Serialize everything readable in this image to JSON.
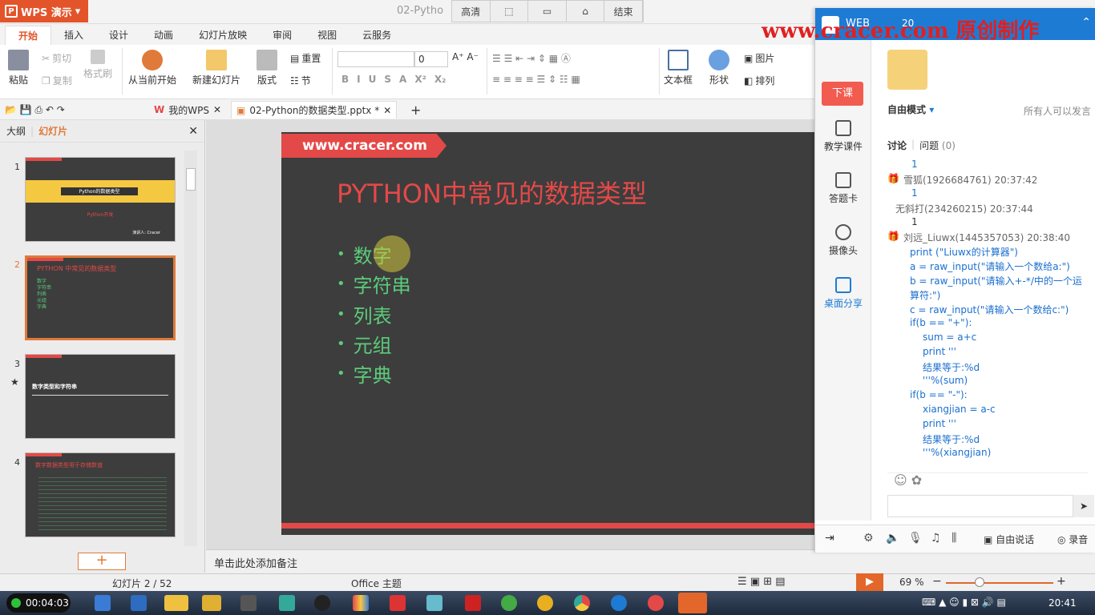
{
  "app": {
    "name": "WPS 演示",
    "doc_title_short": "02-Pytho"
  },
  "float_bar": [
    "高清",
    "",
    "",
    "",
    "结束"
  ],
  "menu_tabs": [
    "开始",
    "插入",
    "设计",
    "动画",
    "幻灯片放映",
    "审阅",
    "视图",
    "云服务"
  ],
  "ribbon": {
    "paste": "粘贴",
    "cut": "剪切",
    "copy": "复制",
    "format_painter": "格式刷",
    "from_current": "从当前开始",
    "new_slide": "新建幻灯片",
    "layout": "版式",
    "reset": "重置",
    "section": "节",
    "font_size": "0",
    "textbox": "文本框",
    "shape": "形状",
    "picture": "图片",
    "arrange": "排列"
  },
  "doc_tabs": {
    "my_wps": "我的WPS",
    "current": "02-Python的数据类型.pptx *"
  },
  "left_panel": {
    "outline": "大纲",
    "slides": "幻灯片"
  },
  "thumbs": {
    "t1_title": "Python的数据类型",
    "t1_sub": "Python开发",
    "t1_author": "演讲人: Cracer",
    "t2_title": "PYTHON 中常见的数据类型",
    "t2_items": [
      "数字",
      "字符串",
      "列表",
      "元组",
      "字典"
    ],
    "t3_title": "数字类型和字符串",
    "t4_title": "数字数据类型用于存储数值"
  },
  "slide": {
    "banner": "www.cracer.com",
    "title": "PYTHON中常见的数据类型",
    "bullets": [
      "数字",
      "字符串",
      "列表",
      "元组",
      "字典"
    ]
  },
  "notes": "单击此处添加备注",
  "status": {
    "slide_pos": "幻灯片 2 / 52",
    "theme": "Office 主题",
    "zoom": "69 %"
  },
  "right_panel": {
    "web": "WEB",
    "count": "20",
    "mode": "自由模式",
    "anyone": "所有人可以发言",
    "tab_discuss": "讨论",
    "tab_question": "问题",
    "question_count": "(0)",
    "nav": [
      "下课",
      "教学课件",
      "答题卡",
      "摄像头",
      "桌面分享"
    ],
    "bottom": [
      "自由说话",
      "录音"
    ]
  },
  "chat": [
    {
      "t": "1",
      "c": "blue",
      "x": 30
    },
    {
      "t": "雪狐(1926684761) 20:37:42",
      "c": "gray",
      "x": 20
    },
    {
      "t": "1",
      "c": "blue",
      "x": 30
    },
    {
      "t": "无斜打(234260215) 20:37:44",
      "c": "gray",
      "x": 10
    },
    {
      "t": "1",
      "c": "dark",
      "x": 30
    },
    {
      "t": "刘远_Liuwx(1445357053) 20:38:40",
      "c": "gray",
      "x": 20
    },
    {
      "t": "print (\"Liuwx的计算器\")",
      "c": "blue",
      "x": 28
    },
    {
      "t": "a = raw_input(\"请输入一个数给a:\")",
      "c": "blue",
      "x": 28
    },
    {
      "t": "b = raw_input(\"请输入+-*/中的一个运",
      "c": "blue",
      "x": 28
    },
    {
      "t": "算符:\")",
      "c": "blue",
      "x": 28
    },
    {
      "t": "c = raw_input(\"请输入一个数给c:\")",
      "c": "blue",
      "x": 28
    },
    {
      "t": "if(b == \"+\"):",
      "c": "blue",
      "x": 28
    },
    {
      "t": "sum = a+c",
      "c": "blue",
      "x": 44
    },
    {
      "t": "print '''",
      "c": "blue",
      "x": 44
    },
    {
      "t": "结果等于:%d",
      "c": "blue",
      "x": 44
    },
    {
      "t": "'''%(sum)",
      "c": "blue",
      "x": 44
    },
    {
      "t": "if(b == \"-\"):",
      "c": "blue",
      "x": 28
    },
    {
      "t": "xiangjian = a-c",
      "c": "blue",
      "x": 44
    },
    {
      "t": "print '''",
      "c": "blue",
      "x": 44
    },
    {
      "t": "结果等于:%d",
      "c": "blue",
      "x": 44
    },
    {
      "t": "'''%(xiangjian)",
      "c": "blue",
      "x": 44
    }
  ],
  "watermark": "www.cracer.com 原创制作",
  "taskbar": {
    "recording_time": "00:04:03",
    "clock": "20:41"
  }
}
